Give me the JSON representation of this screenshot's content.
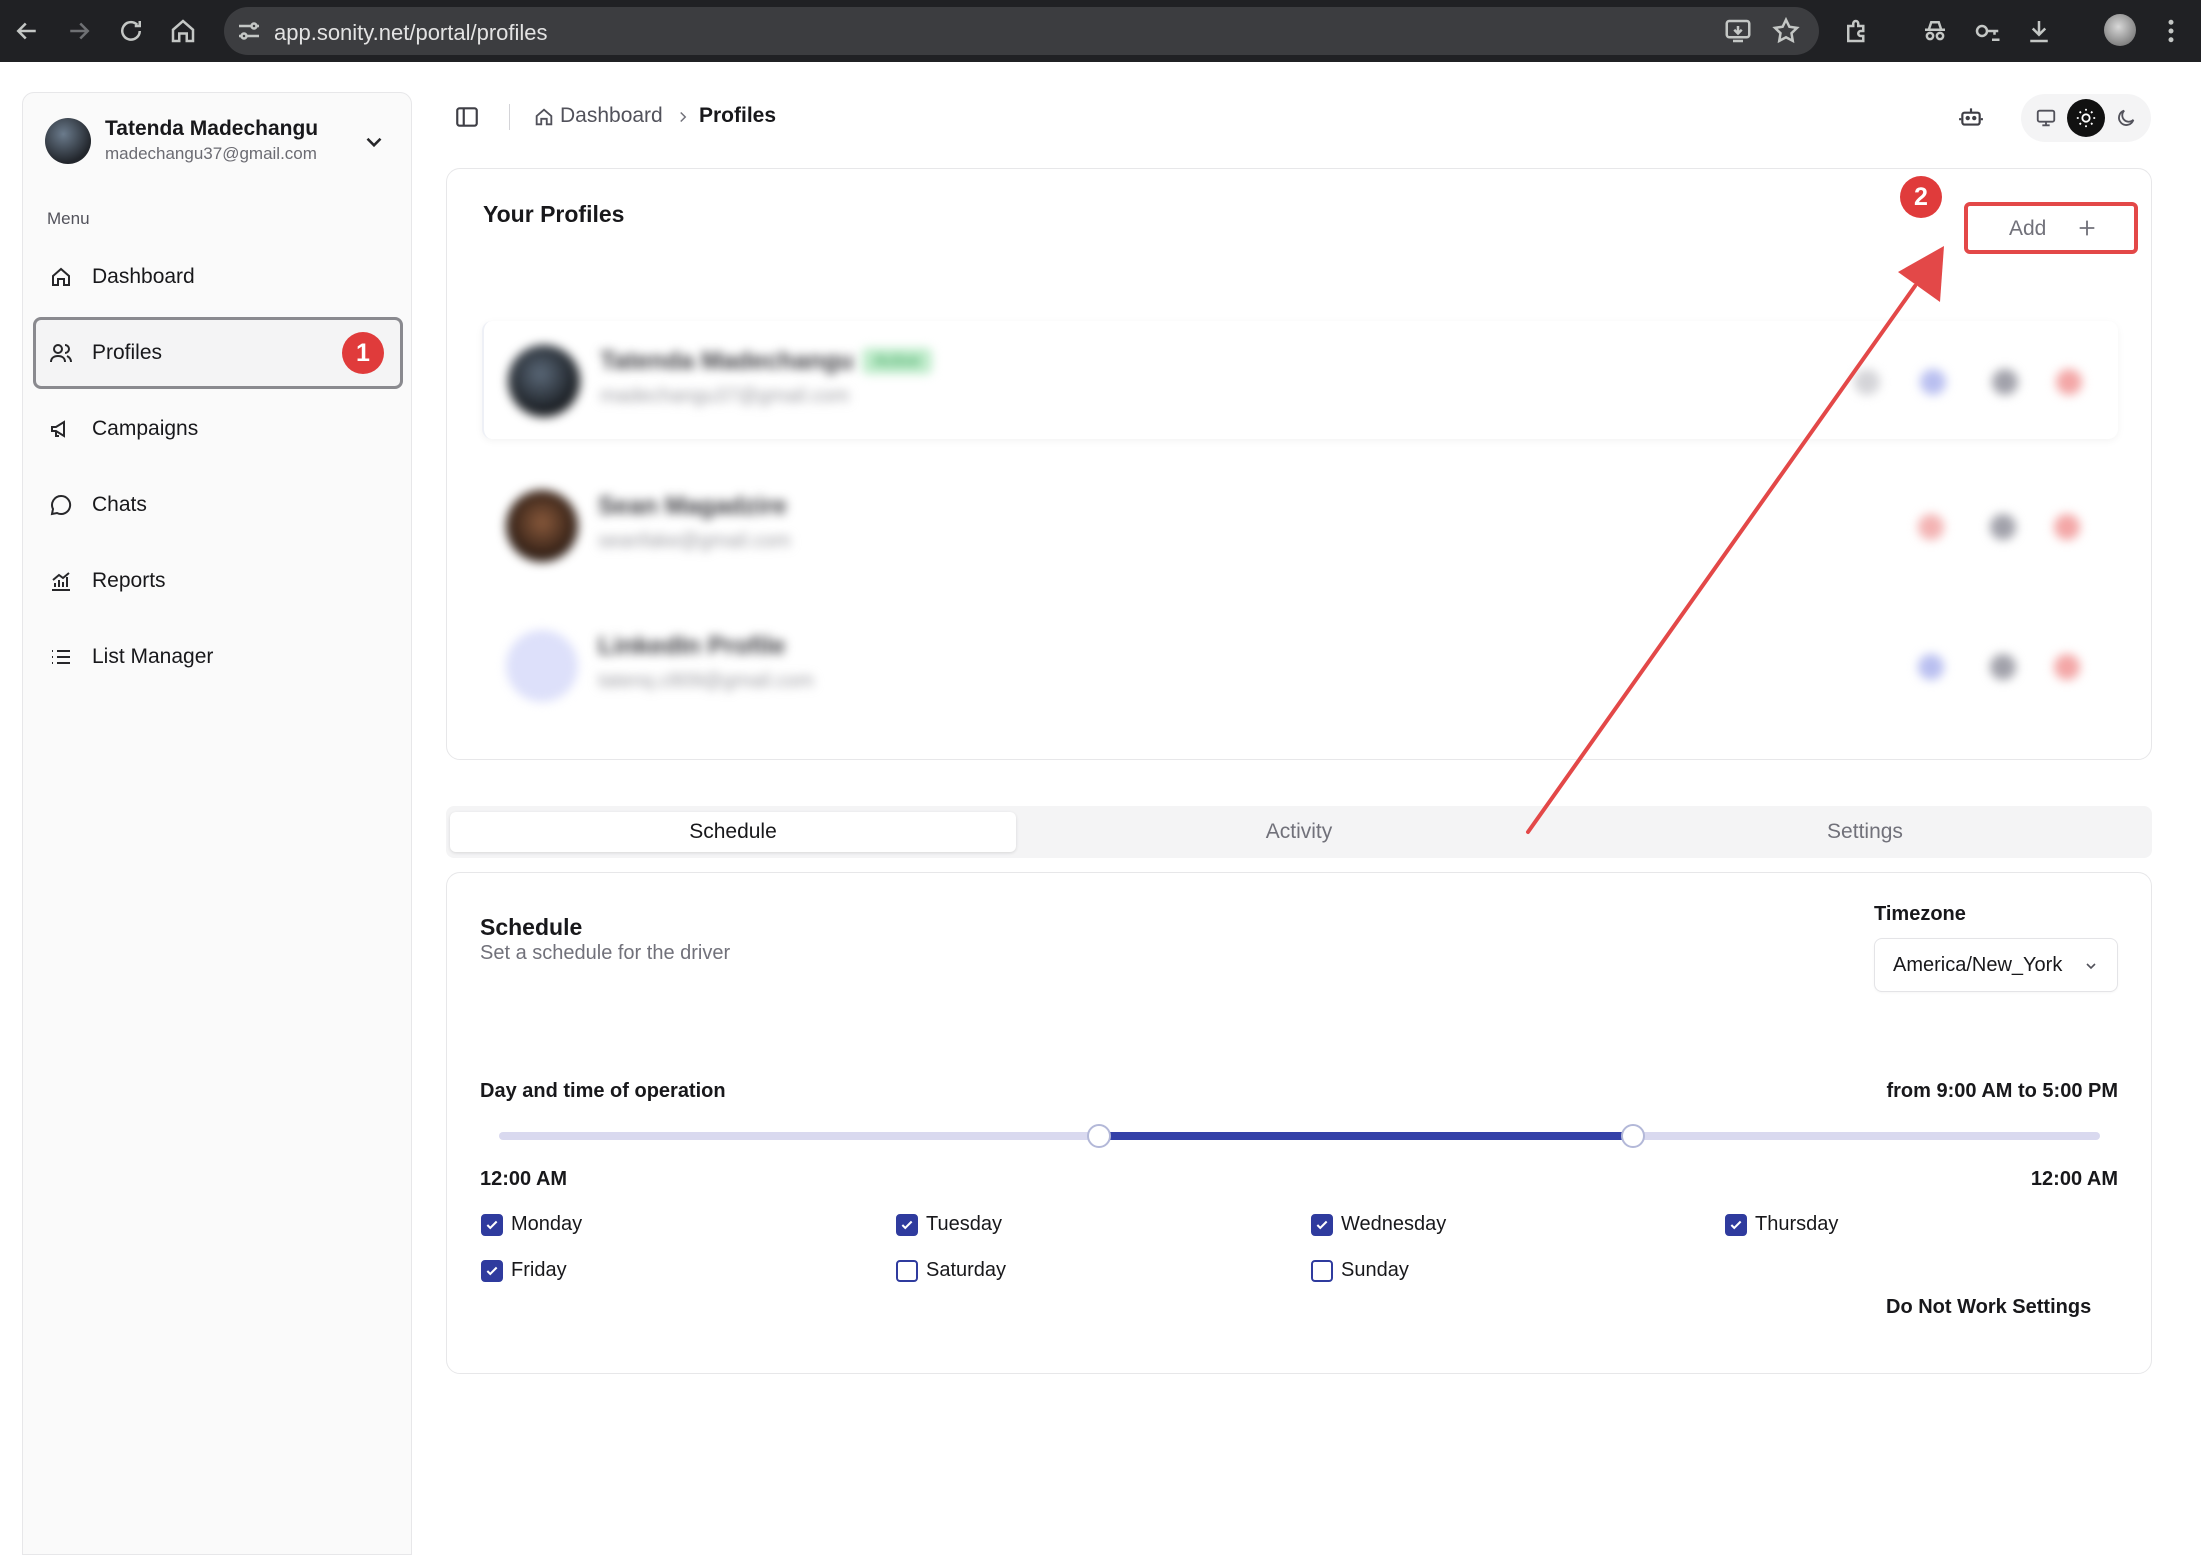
{
  "browser": {
    "url": "app.sonity.net/portal/profiles"
  },
  "user": {
    "name": "Tatenda Madechangu",
    "email": "madechangu37@gmail.com"
  },
  "sidebar": {
    "menu_label": "Menu",
    "items": [
      {
        "label": "Dashboard",
        "icon": "home-icon"
      },
      {
        "label": "Profiles",
        "icon": "users-icon"
      },
      {
        "label": "Campaigns",
        "icon": "megaphone-icon"
      },
      {
        "label": "Chats",
        "icon": "chat-bubble-icon"
      },
      {
        "label": "Reports",
        "icon": "bar-chart-icon"
      },
      {
        "label": "List Manager",
        "icon": "list-icon"
      }
    ]
  },
  "annotations": {
    "badge1": "1",
    "badge2": "2",
    "accent": "#e03b3b"
  },
  "breadcrumb": {
    "root": "Dashboard",
    "current": "Profiles"
  },
  "profiles_card": {
    "title": "Your Profiles",
    "add_label": "Add",
    "rows": [
      {
        "name": "Tatenda Madechangu",
        "email": "madechangu37@gmail.com",
        "badge": "Active"
      },
      {
        "name": "Sean Magadzire",
        "email": "seanfake@gmail.com"
      },
      {
        "name": "LinkedIn Profile",
        "email": "tatenq.c809@gmail.com"
      }
    ]
  },
  "tabs": [
    "Schedule",
    "Activity",
    "Settings"
  ],
  "schedule": {
    "title": "Schedule",
    "subtitle": "Set a schedule for the driver",
    "timezone_label": "Timezone",
    "timezone_value": "America/New_York",
    "day_time_label": "Day and time of operation",
    "range_text": "from 9:00 AM to 5:00 PM",
    "slider_start_fraction": 0.375,
    "slider_end_fraction": 0.7083,
    "time_min": "12:00 AM",
    "time_max": "12:00 AM",
    "days": [
      {
        "label": "Monday",
        "checked": true
      },
      {
        "label": "Tuesday",
        "checked": true
      },
      {
        "label": "Wednesday",
        "checked": true
      },
      {
        "label": "Thursday",
        "checked": true
      },
      {
        "label": "Friday",
        "checked": true
      },
      {
        "label": "Saturday",
        "checked": false
      },
      {
        "label": "Sunday",
        "checked": false
      }
    ],
    "do_not_work": "Do Not Work Settings"
  },
  "colors": {
    "primary": "#2f3b9e",
    "slider_track": "#d9d9ef",
    "active_badge_bg": "#bfeccb"
  }
}
